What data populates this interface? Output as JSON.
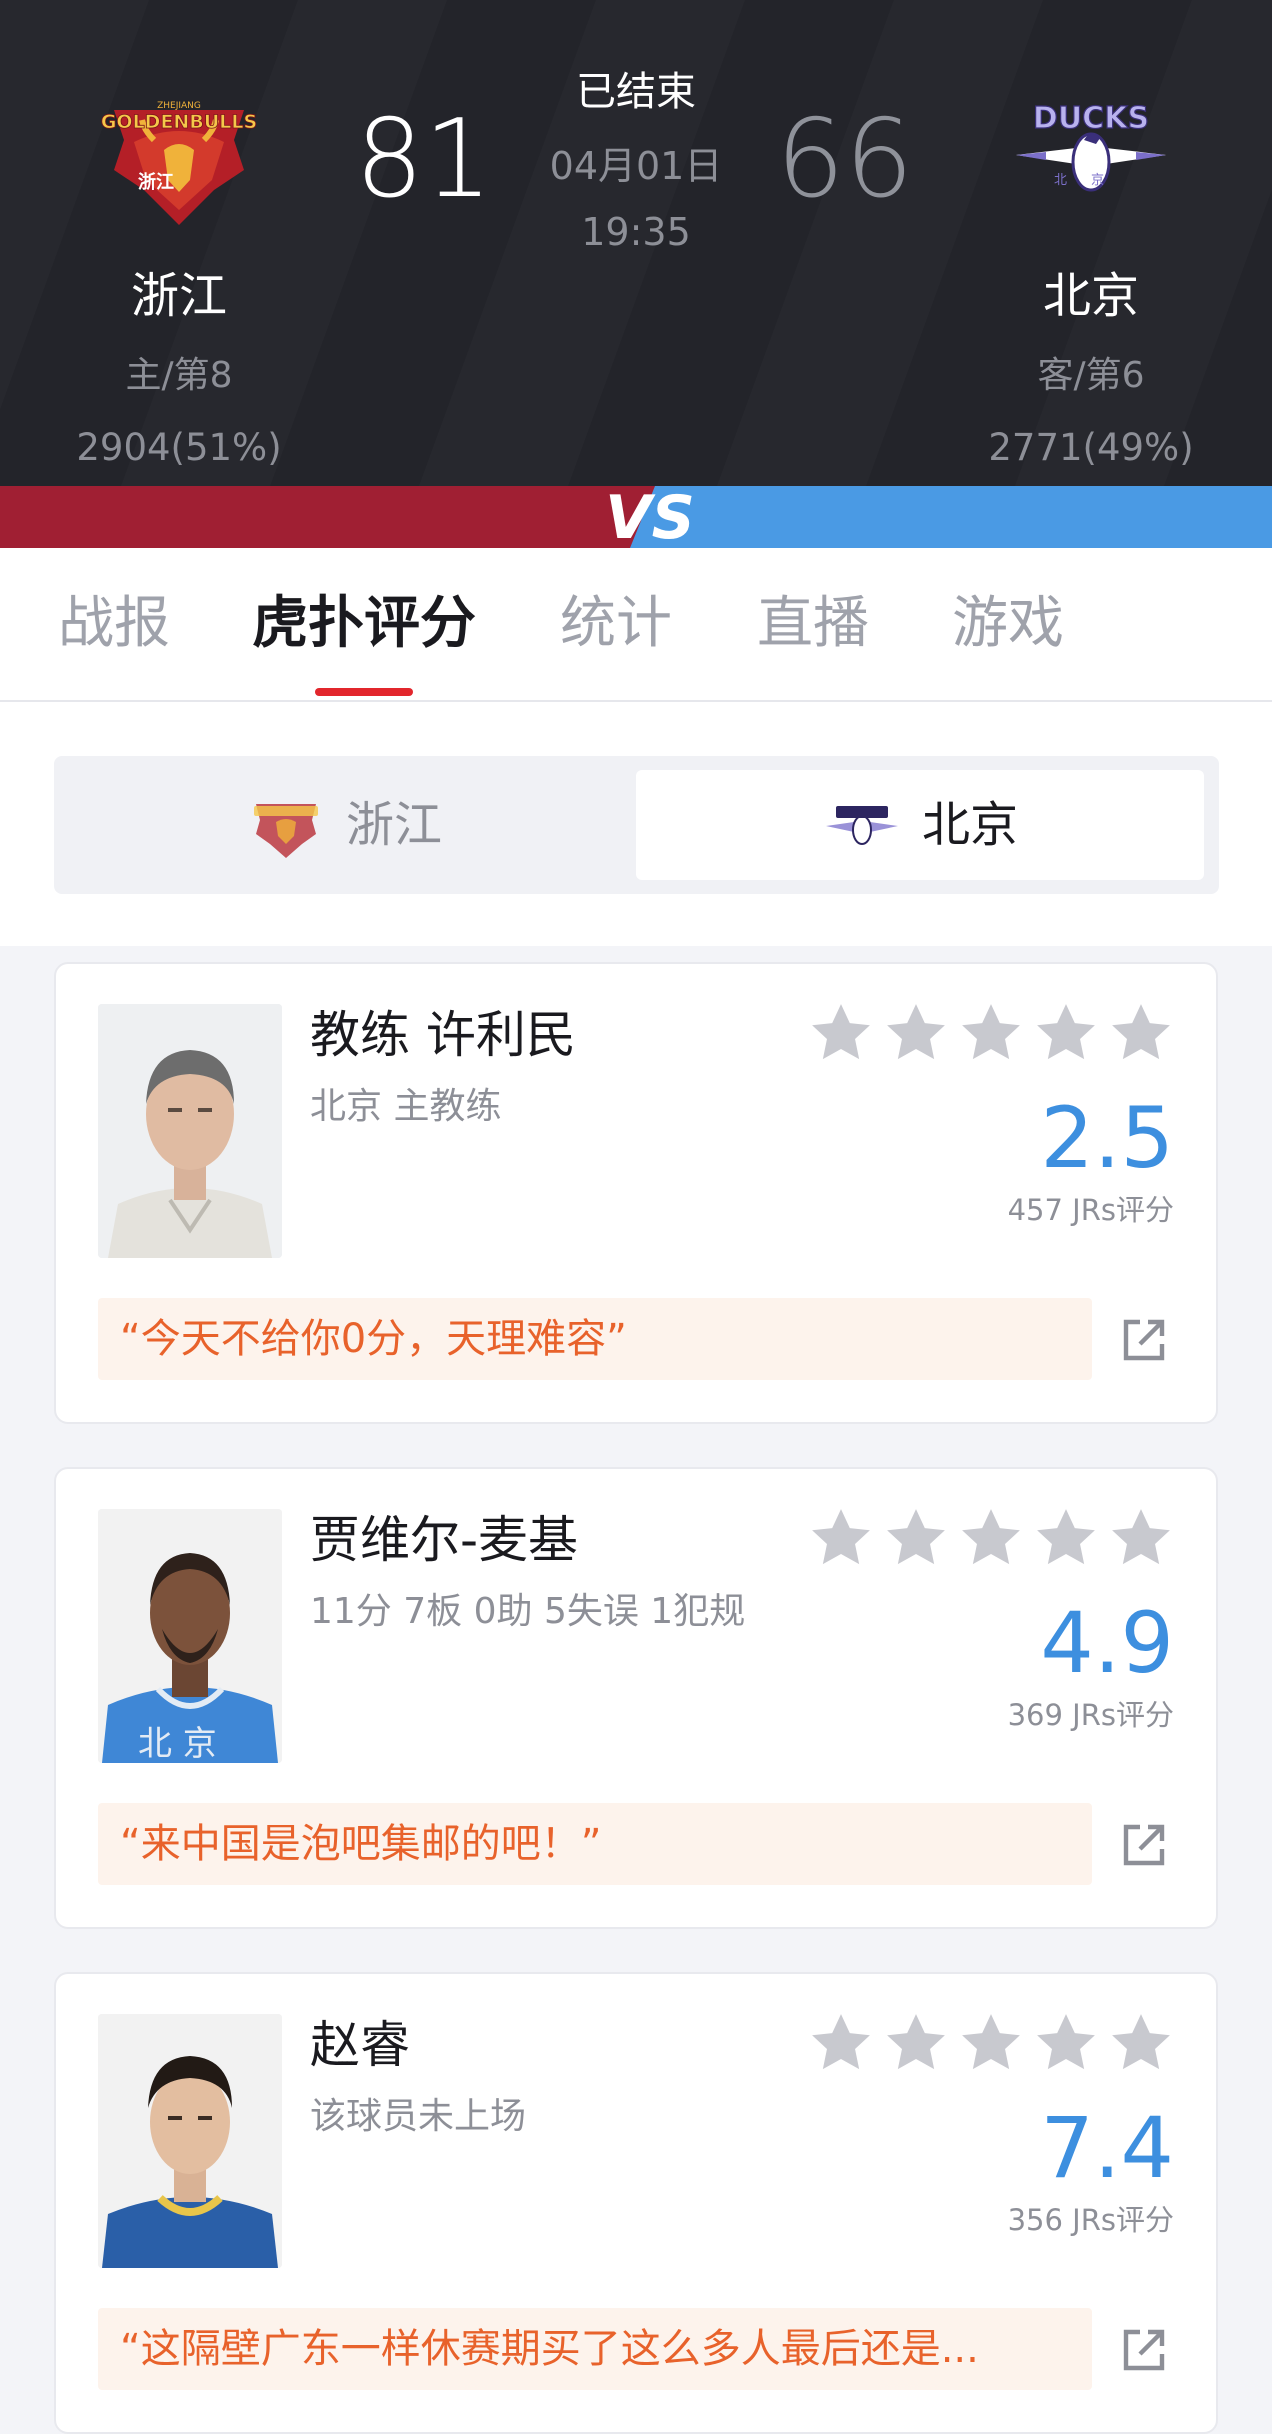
{
  "match": {
    "status": "已结束",
    "date": "04月01日",
    "time": "19:35",
    "home": {
      "name": "浙江",
      "score": "81",
      "rank": "主/第8",
      "votes": "2904(51%)",
      "logo_text": "GOLDENBULLS",
      "logo_sub": "ZHEJIANG",
      "logo_cn": "浙江"
    },
    "away": {
      "name": "北京",
      "score": "66",
      "rank": "客/第6",
      "votes": "2771(49%)",
      "logo_text": "DUCKS",
      "logo_cn": "北京"
    }
  },
  "vs_label": "VS",
  "colors": {
    "home": "#a01f33",
    "away": "#4a9ae4",
    "accent": "#e2262c",
    "rating": "#3d8fdf",
    "quote_text": "#e8622b",
    "star": "#c8c9cf"
  },
  "tabs": [
    {
      "label": "战报",
      "active": false
    },
    {
      "label": "虎扑评分",
      "active": true
    },
    {
      "label": "统计",
      "active": false
    },
    {
      "label": "直播",
      "active": false
    },
    {
      "label": "游戏",
      "active": false
    }
  ],
  "team_switch": {
    "left": "浙江",
    "right": "北京",
    "selected": "北京"
  },
  "cards": [
    {
      "name": "教练 许利民",
      "sub": "北京 主教练",
      "rating": "2.5",
      "votes": "457 JRs评分",
      "quote": "“今天不给你0分，天理难容”",
      "stars_filled": 0
    },
    {
      "name": "贾维尔-麦基",
      "sub": "11分 7板 0助 5失误 1犯规",
      "rating": "4.9",
      "votes": "369 JRs评分",
      "quote": "“来中国是泡吧集邮的吧！”",
      "stars_filled": 0
    },
    {
      "name": "赵睿",
      "sub": "该球员未上场",
      "rating": "7.4",
      "votes": "356 JRs评分",
      "quote": "“这隔壁广东一样休赛期买了这么多人最后还是...",
      "stars_filled": 0
    }
  ],
  "icons": {
    "star": "star-icon",
    "share": "share-icon",
    "home_logo": "goldenbulls-logo",
    "away_logo": "ducks-logo"
  }
}
